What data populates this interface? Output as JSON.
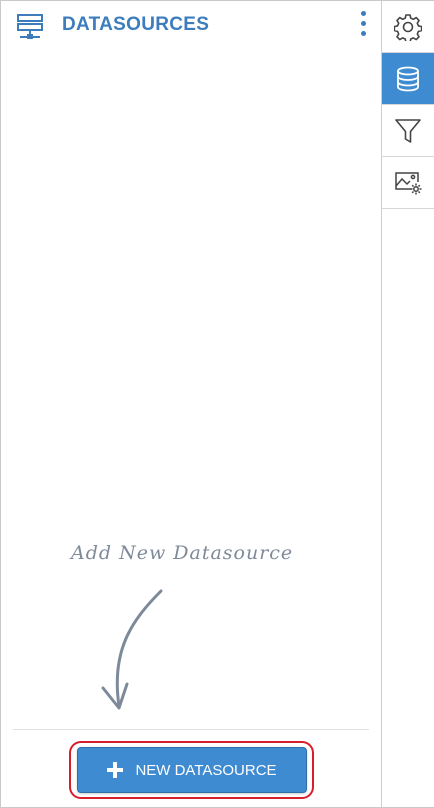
{
  "panel": {
    "title": "DATASOURCES",
    "header_icon": "server-rack-icon",
    "menu_icon": "more-vertical-icon"
  },
  "empty_state": {
    "hint_text": "Add New Datasource",
    "arrow_icon": "curved-arrow-down-icon"
  },
  "footer": {
    "new_button_label": "NEW DATASOURCE",
    "new_button_icon": "plus-icon"
  },
  "toolbar": {
    "items": [
      {
        "name": "settings",
        "icon": "gear-icon",
        "active": false
      },
      {
        "name": "datasources",
        "icon": "database-icon",
        "active": true
      },
      {
        "name": "filter",
        "icon": "filter-icon",
        "active": false
      },
      {
        "name": "image-settings",
        "icon": "image-settings-icon",
        "active": false
      }
    ]
  },
  "colors": {
    "accent": "#3f8bd1",
    "title": "#3d7dbd",
    "highlight_border": "#d81e2a",
    "hint_text": "#7e8a99"
  }
}
